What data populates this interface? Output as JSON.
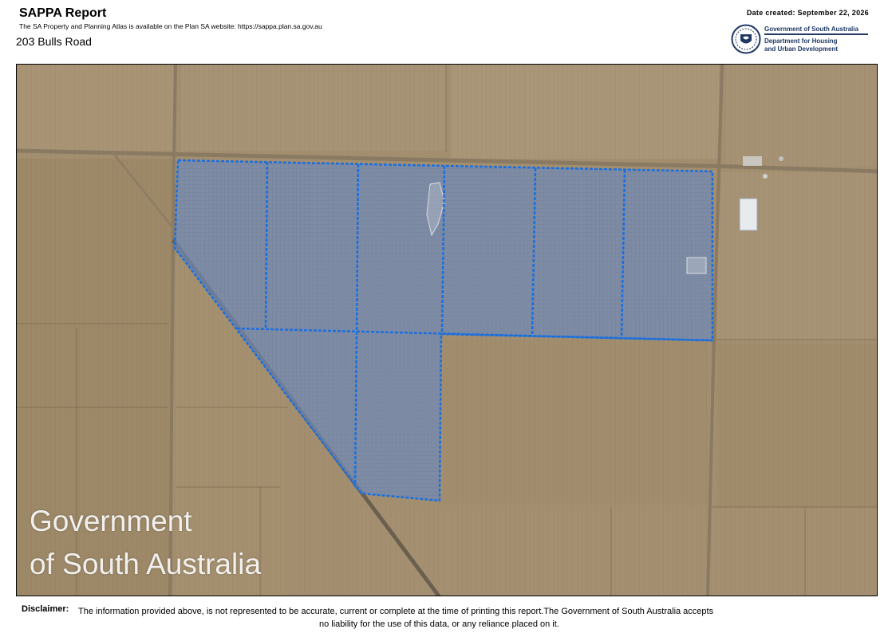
{
  "header": {
    "title": "SAPPA Report",
    "subtitle": "The SA Property and Planning Atlas is available on the Plan SA website: https://sappa.plan.sa.gov.au",
    "address": "203 Bulls Road",
    "date_created": "Date created: September 22, 2026"
  },
  "logo": {
    "line1": "Government of South Australia",
    "line2a": "Department for Housing",
    "line2b": "and Urban Development",
    "icon": "sa-government-crest-icon",
    "color": "#1f3864"
  },
  "map": {
    "watermark_line1": "Government",
    "watermark_line2": "of South Australia",
    "parcel_outline_color": "#1a6fe0",
    "parcel_fill_color": "#6f89b8"
  },
  "disclaimer": {
    "label": "Disclaimer:",
    "text_line1": "The information provided above, is not represented to be accurate, current or complete at the time of printing this report.The Government of South Australia accepts",
    "text_line2": "no liability for the use of this data, or any reliance placed on it."
  }
}
